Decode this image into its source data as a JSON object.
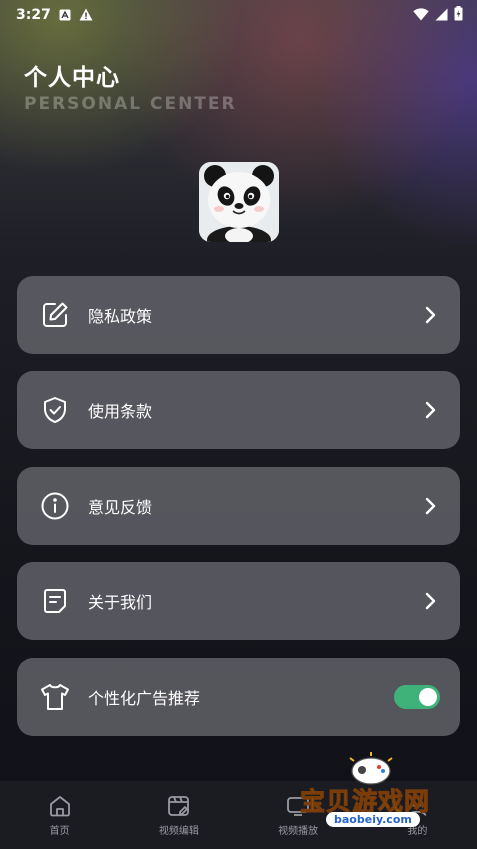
{
  "status_bar": {
    "time": "3:27"
  },
  "header": {
    "title": "个人中心",
    "subtitle": "PERSONAL CENTER"
  },
  "menu": {
    "items": [
      {
        "label": "隐私政策",
        "icon": "edit-icon"
      },
      {
        "label": "使用条款",
        "icon": "shield-check-icon"
      },
      {
        "label": "意见反馈",
        "icon": "info-icon"
      },
      {
        "label": "关于我们",
        "icon": "document-icon"
      }
    ],
    "ad_toggle": {
      "label": "个性化广告推荐",
      "icon": "tshirt-icon",
      "enabled": true
    }
  },
  "bottom_nav": {
    "items": [
      {
        "label": "首页",
        "icon": "home-icon"
      },
      {
        "label": "视频编辑",
        "icon": "video-edit-icon"
      },
      {
        "label": "视频播放",
        "icon": "video-play-icon"
      },
      {
        "label": "我的",
        "icon": "user-icon"
      }
    ]
  },
  "watermark": {
    "title": "宝贝游戏网",
    "url": "baobeiy.com"
  },
  "colors": {
    "toggle_on": "#3fb27a",
    "card_bg": "#686870"
  }
}
